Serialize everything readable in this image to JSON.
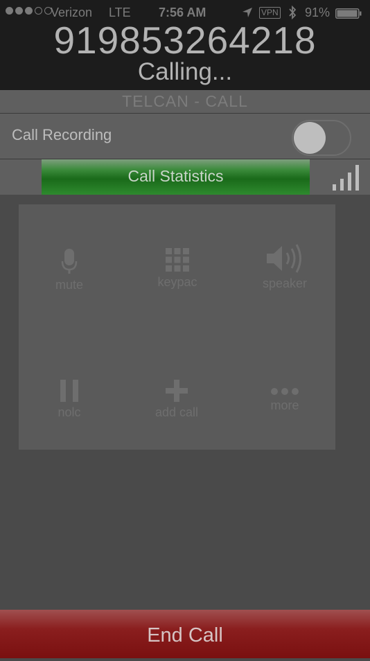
{
  "status_bar": {
    "carrier": "Verizon",
    "network": "LTE",
    "time": "7:56 AM",
    "vpn": "VPN",
    "battery_percent": "91%",
    "signal_dots_filled": 3,
    "signal_dots_total": 5
  },
  "call": {
    "number": "919853264218",
    "status": "Calling..."
  },
  "app_title": "TELCAN - CALL",
  "call_recording": {
    "label": "Call Recording",
    "enabled": false
  },
  "call_statistics": {
    "label": "Call Statistics"
  },
  "keypad_buttons": [
    {
      "label": "mute",
      "icon": "microphone-icon"
    },
    {
      "label": "keypac",
      "icon": "keypad-icon"
    },
    {
      "label": "speaker",
      "icon": "speaker-icon"
    },
    {
      "label": "nolc",
      "icon": "pause-icon"
    },
    {
      "label": "add call",
      "icon": "plus-icon"
    },
    {
      "label": "more",
      "icon": "ellipsis-icon"
    }
  ],
  "end_call_label": "End Call",
  "colors": {
    "top_bar": "#1c1c1c",
    "call_statistics_green": "#2e8a2e",
    "end_call_red": "#8a1e1e",
    "background": "#4a4a4a"
  }
}
